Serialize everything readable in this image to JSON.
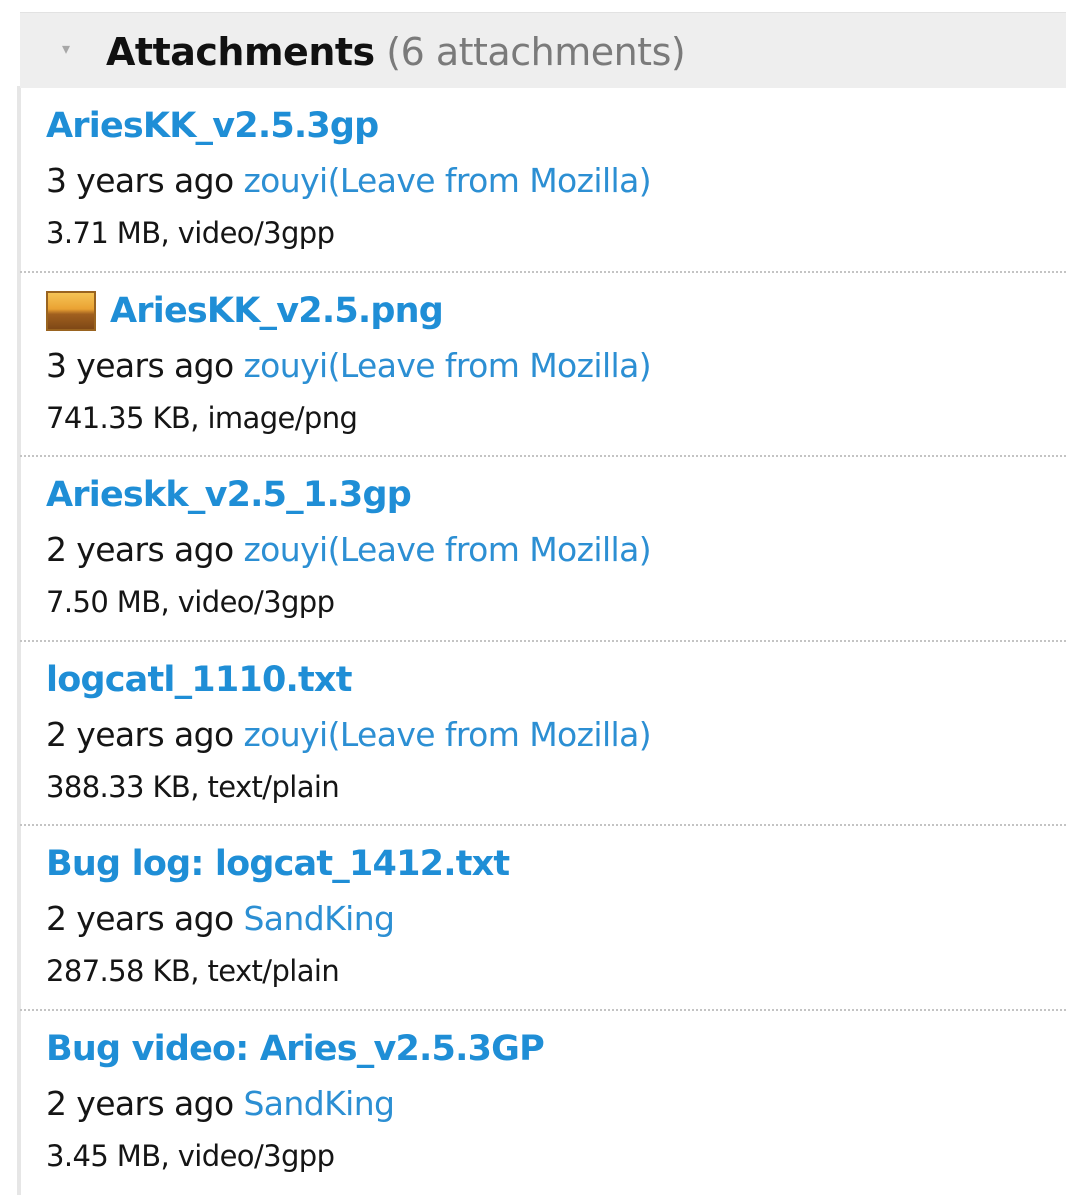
{
  "header": {
    "twisty_glyph": "▾",
    "title": "Attachments",
    "count": "(6 attachments)"
  },
  "attachments": [
    {
      "name": "AriesKK_v2.5.3gp",
      "age": "3 years ago",
      "user": "zouyi(Leave from Mozilla)",
      "info": "3.71 MB, video/3gpp",
      "thumbnail": false
    },
    {
      "name": "AriesKK_v2.5.png",
      "age": "3 years ago",
      "user": "zouyi(Leave from Mozilla)",
      "info": "741.35 KB, image/png",
      "thumbnail": true,
      "thumbnail_icon": "image-thumbnail-icon"
    },
    {
      "name": "Arieskk_v2.5_1.3gp",
      "age": "2 years ago",
      "user": "zouyi(Leave from Mozilla)",
      "info": "7.50 MB, video/3gpp",
      "thumbnail": false
    },
    {
      "name": "logcatl_1110.txt",
      "age": "2 years ago",
      "user": "zouyi(Leave from Mozilla)",
      "info": "388.33 KB, text/plain",
      "thumbnail": false
    },
    {
      "name": "Bug log: logcat_1412.txt",
      "age": "2 years ago",
      "user": "SandKing",
      "info": "287.58 KB, text/plain",
      "thumbnail": false
    },
    {
      "name": "Bug video: Aries_v2.5.3GP",
      "age": "2 years ago",
      "user": "SandKing",
      "info": "3.45 MB, video/3gpp",
      "thumbnail": false
    }
  ],
  "colors": {
    "link": "#1f8ed6",
    "user_link": "#2c8fd3",
    "header_bg": "#eeeeee",
    "separator": "#c4c4c4"
  }
}
